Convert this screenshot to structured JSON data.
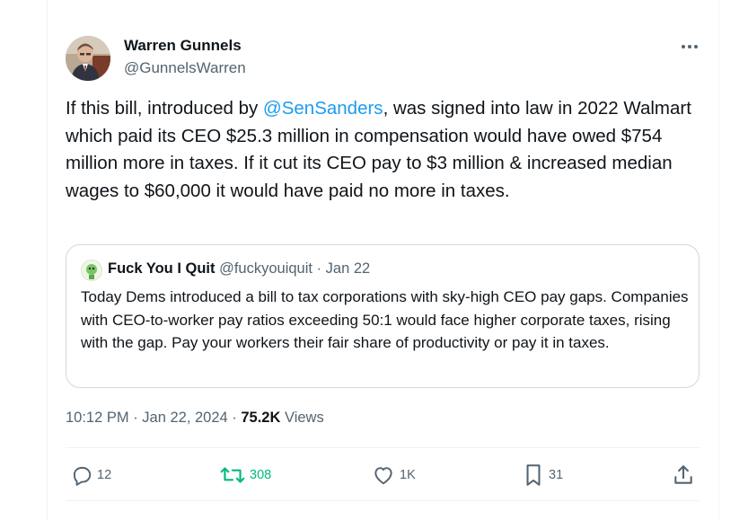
{
  "tweet": {
    "author_name": "Warren Gunnels",
    "author_handle": "@GunnelsWarren",
    "text_before_mention": "If this bill, introduced by ",
    "mention": "@SenSanders",
    "text_after_mention": ", was signed into law in 2022 Walmart which paid its CEO $25.3 million in compensation would have owed $754 million more in taxes. If it cut its CEO pay to $3 million & increased median wages to $60,000 it would have paid no more in taxes.",
    "timestamp": "10:12 PM · Jan 22, 2024",
    "meta_separator": " · ",
    "views_count": "75.2K",
    "views_label": " Views"
  },
  "quote": {
    "name": "Fuck You I Quit",
    "handle": "@fuckyouiquit",
    "separator": " · ",
    "date": "Jan 22",
    "text": "Today Dems introduced a bill to tax corporations with sky-high CEO pay gaps. Companies with CEO-to-worker pay ratios exceeding 50:1 would face higher corporate taxes, rising with the gap. Pay your workers their fair share of productivity or pay it in taxes."
  },
  "actions": {
    "replies": "12",
    "retweets": "308",
    "likes": "1K",
    "bookmarks": "31"
  },
  "icons": [
    "more-icon",
    "reply-icon",
    "retweet-icon",
    "like-icon",
    "bookmark-icon",
    "share-icon"
  ],
  "colors": {
    "accent": "#1d9bf0",
    "retweet": "#00ba7c",
    "muted": "#536471",
    "text": "#0f1419",
    "border": "#cfd9de"
  }
}
